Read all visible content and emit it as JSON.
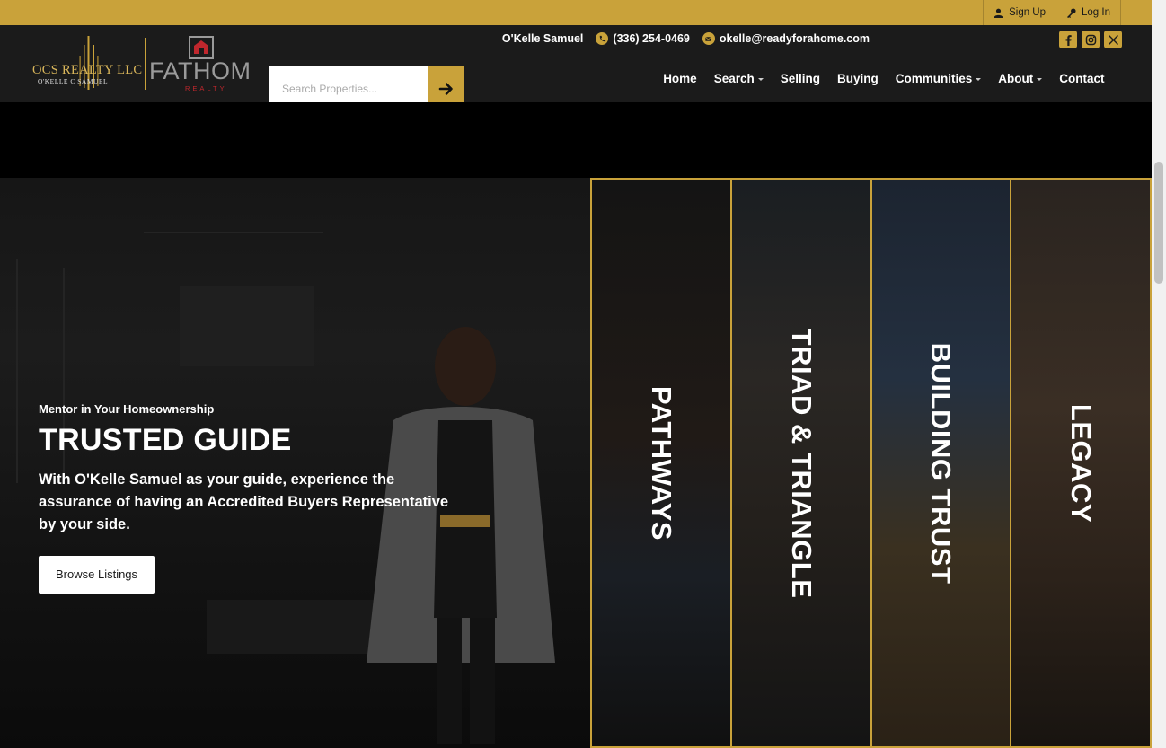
{
  "auth": {
    "signup": "Sign Up",
    "login": "Log In"
  },
  "brand": {
    "ocs_name": "OCS REALTY LLC",
    "ocs_sub": "O'KELLE C SAMUEL",
    "fathom_name": "FATHOM",
    "fathom_sub": "REALTY"
  },
  "search": {
    "placeholder": "Search Properties..."
  },
  "contact": {
    "agent": "O'Kelle Samuel",
    "phone": "(336) 254-0469",
    "email": "okelle@readyforahome.com"
  },
  "socials": [
    "facebook-icon",
    "instagram-icon",
    "x-icon"
  ],
  "nav": {
    "home": "Home",
    "search": "Search",
    "selling": "Selling",
    "buying": "Buying",
    "communities": "Communities",
    "about": "About",
    "contact": "Contact"
  },
  "hero": {
    "kicker": "Mentor in Your Homeownership",
    "title": "TRUSTED GUIDE",
    "description": "With O'Kelle Samuel as your guide, experience the assurance of having an Accredited Buyers Representative by your side.",
    "button": "Browse Listings"
  },
  "panels": [
    "PATHWAYS",
    "TRIAD & TRIANGLE",
    "BUILDING TRUST",
    "LEGACY"
  ],
  "colors": {
    "gold": "#c9a23a",
    "header": "#1b1b1b",
    "hero": "#000000"
  }
}
